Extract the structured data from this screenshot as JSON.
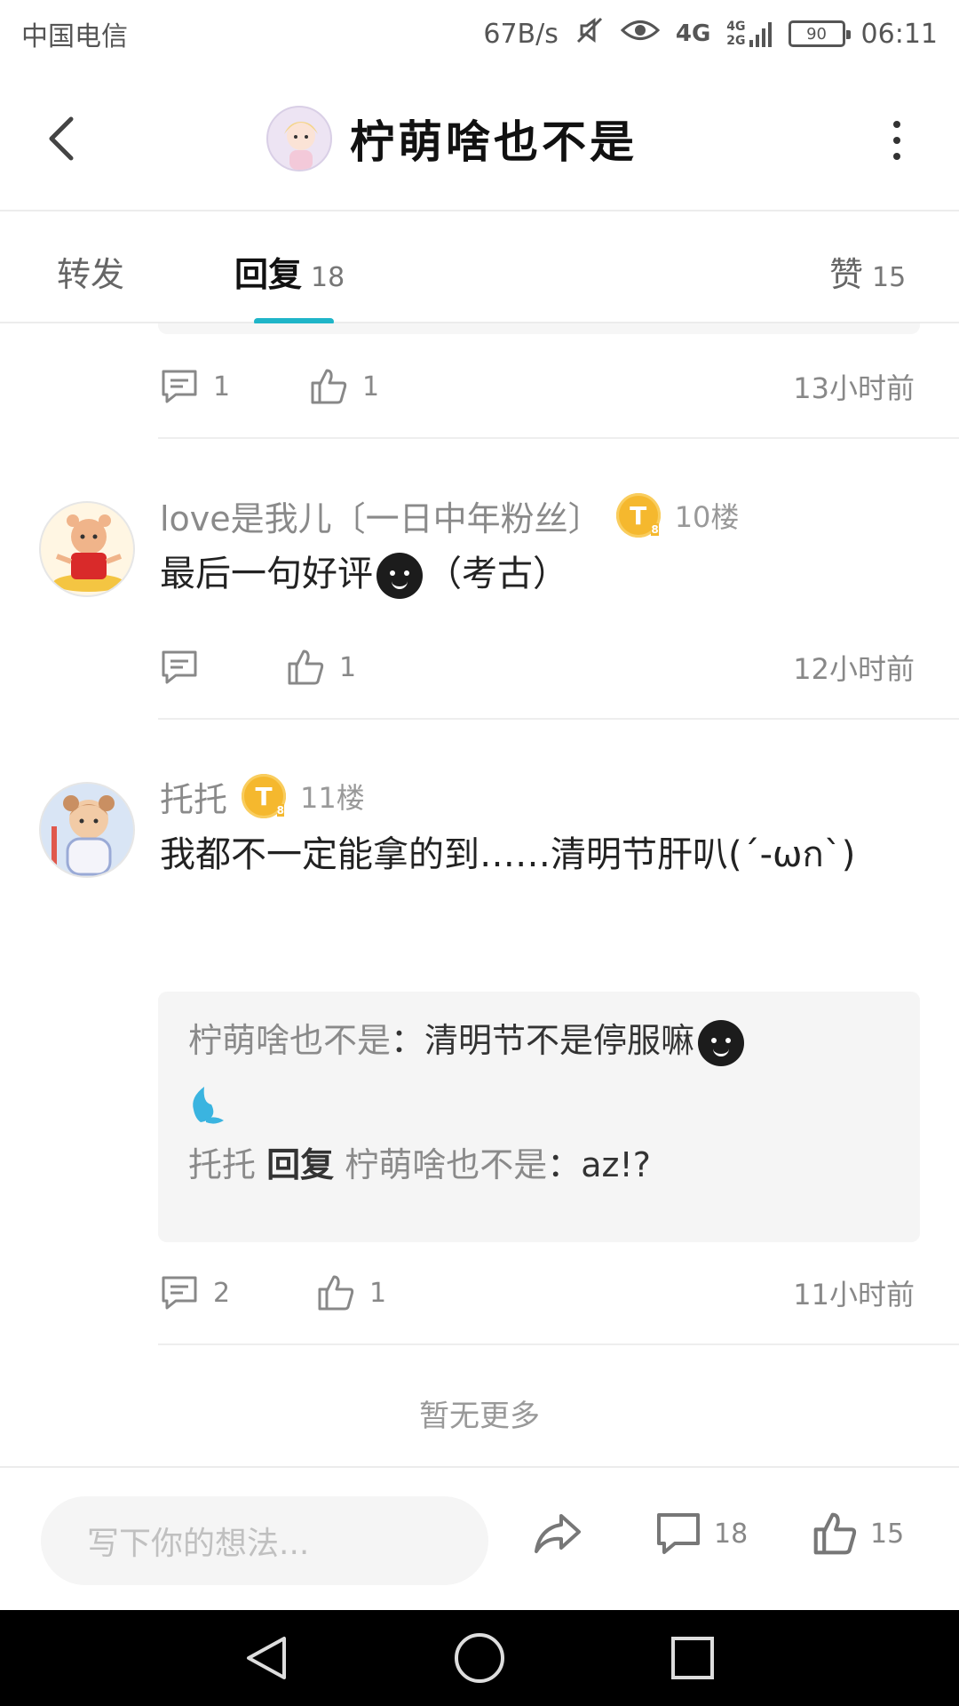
{
  "status_bar": {
    "carrier": "中国电信",
    "speed": "67B/s",
    "network": "4G",
    "network_small_top": "4G",
    "network_small_bottom": "2G",
    "battery": "90",
    "time": "06:11"
  },
  "header": {
    "title": "柠萌啥也不是"
  },
  "tabs": {
    "repost": {
      "label": "转发"
    },
    "reply": {
      "label": "回复",
      "count": "18"
    },
    "like": {
      "label": "赞",
      "count": "15"
    }
  },
  "prev_item": {
    "comment_count": "1",
    "like_count": "1",
    "time": "13小时前"
  },
  "comments": [
    {
      "user": "love是我儿〔一日中年粉丝〕",
      "badge": "T",
      "badge_sub": "8",
      "floor": "10楼",
      "text_before": "最后一句好评",
      "text_after": "（考古）",
      "comment_count": "",
      "like_count": "1",
      "time": "12小时前"
    },
    {
      "user": "托托",
      "badge": "T",
      "badge_sub": "8",
      "floor": "11楼",
      "text": "我都不一定能拿的到……清明节肝叭(´-ωก`)",
      "replies": [
        {
          "author": "柠萌啥也不是",
          "sep": "：",
          "text": "清明节不是停服嘛"
        },
        {
          "author": "托托",
          "keyword": "回复",
          "target": "柠萌啥也不是",
          "sep": "：",
          "text": "az!?"
        }
      ],
      "comment_count": "2",
      "like_count": "1",
      "time": "11小时前"
    }
  ],
  "no_more": "暂无更多",
  "bottom_bar": {
    "input_placeholder": "写下你的想法...",
    "comment_count": "18",
    "like_count": "15"
  },
  "colors": {
    "accent": "#1fb5c8",
    "badge": "#f5b82e",
    "reply_bg": "#f5f5f5"
  }
}
